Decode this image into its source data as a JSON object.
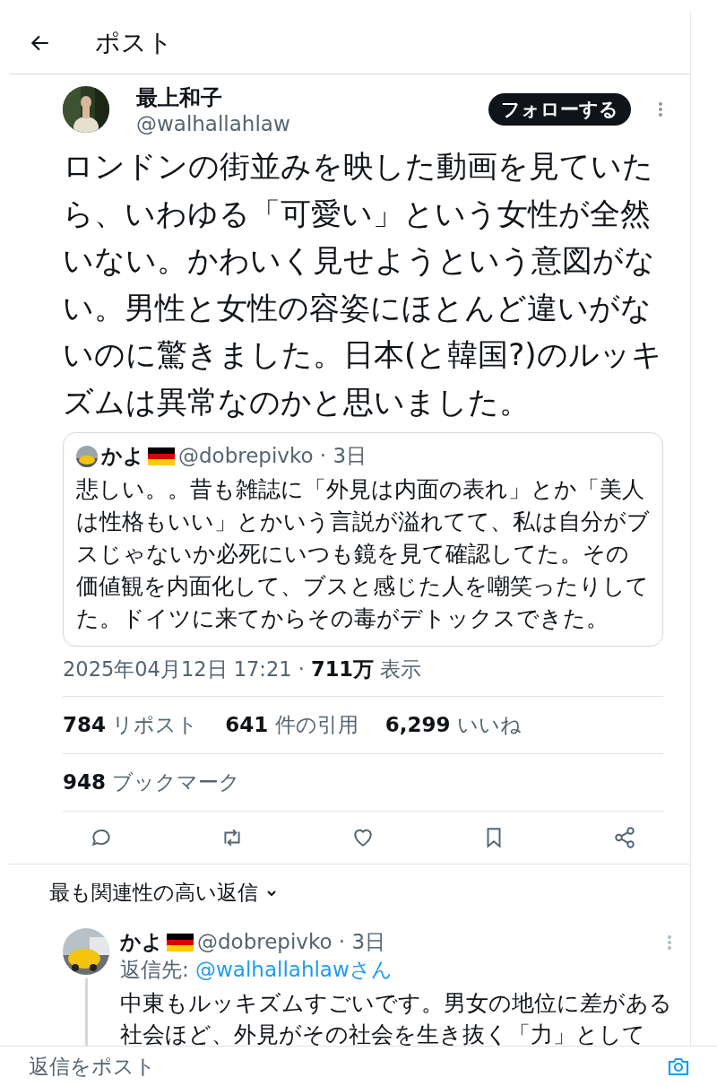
{
  "header": {
    "title": "ポスト"
  },
  "post": {
    "name": "最上和子",
    "handle": "@walhallahlaw",
    "follow_label": "フォローする",
    "text": "ロンドンの街並みを映した動画を見ていたら、いわゆる「可愛い」という女性が全然いない。かわいく見せようという意図がない。男性と女性の容姿にほとんど違いがないのに驚きました。日本(と韓国?)のルッキズムは異常なのかと思いました。",
    "quote": {
      "name": "かよ",
      "handle": "@dobrepivko · 3日",
      "text": "悲しい。。昔も雑誌に「外見は内面の表れ」とか「美人は性格もいい」とかいう言説が溢れてて、私は自分がブスじゃないか必死にいつも鏡を見て確認してた。その価値観を内面化して、ブスと感じた人を嘲笑ったりしてた。ドイツに来てからその毒がデトックスできた。"
    },
    "timestamp": "2025年04月12日 17:21 · ",
    "views_count": "711万",
    "views_label": " 表示",
    "stats": [
      {
        "count": "784",
        "label": "リポスト"
      },
      {
        "count": "641",
        "label": "件の引用"
      },
      {
        "count": "6,299",
        "label": "いいね"
      }
    ],
    "bookmarks": {
      "count": "948",
      "label": "ブックマーク"
    },
    "actions": [
      {
        "kind": "reply"
      },
      {
        "kind": "repost"
      },
      {
        "kind": "like"
      },
      {
        "kind": "bookmark"
      },
      {
        "kind": "share"
      }
    ]
  },
  "replies_sort": {
    "label": "最も関連性の高い返信"
  },
  "replies": [
    {
      "name": "かよ",
      "handle": "@dobrepivko · 3日",
      "reply_to_label": "返信先: ",
      "reply_to": "@walhallahlawさん",
      "text": "中東もルッキズムすごいです。男女の地位に差がある社会ほど、外見がその社会を生き抜く「力」として"
    }
  ],
  "reply_bar": {
    "placeholder": "返信をポスト"
  }
}
